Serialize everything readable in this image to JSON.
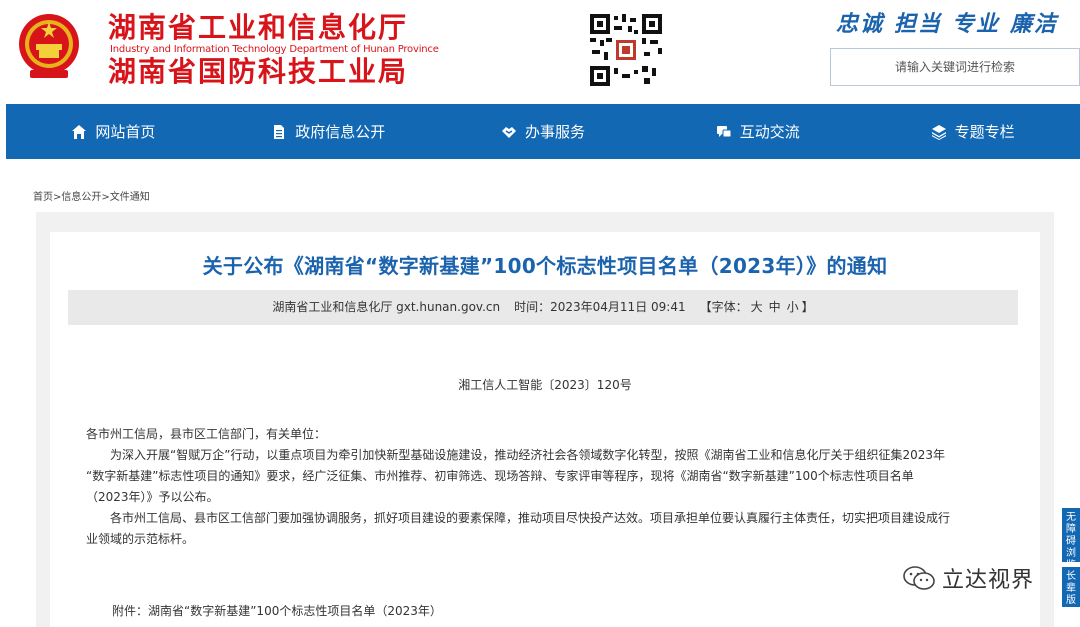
{
  "header": {
    "title_line1": "湖南省工业和信息化厅",
    "title_en": "Industry and Information Technology Department of Hunan Province",
    "title_line2": "湖南省国防科技工业局",
    "slogan": [
      "忠诚",
      "担当",
      "专业",
      "廉洁"
    ],
    "search_placeholder": "请输入关键词进行检索",
    "brand_color": "#d8141b",
    "accent_color": "#1368b4"
  },
  "nav": {
    "items": [
      {
        "label": "网站首页",
        "icon": "home-icon"
      },
      {
        "label": "政府信息公开",
        "icon": "document-icon"
      },
      {
        "label": "办事服务",
        "icon": "handshake-icon"
      },
      {
        "label": "互动交流",
        "icon": "chat-icon"
      },
      {
        "label": "专题专栏",
        "icon": "layers-icon"
      }
    ]
  },
  "breadcrumb": [
    "首页",
    "信息公开",
    "文件通知"
  ],
  "article": {
    "title": "关于公布《湖南省“数字新基建”100个标志性项目名单（2023年）》的通知",
    "source": "湖南省工业和信息化厅 gxt.hunan.gov.cn",
    "time": "时间：2023年04月11日 09:41",
    "font_label": "【字体：",
    "font_sizes": [
      "大",
      "中",
      "小"
    ],
    "font_close": "】",
    "doc_number": "湘工信人工智能〔2023〕120号",
    "salutation": "各市州工信局，县市区工信部门，有关单位：",
    "para1_line1": "为深入开展“智赋万企”行动，以重点项目为牵引加快新型基础设施建设，推动经济社会各领域数字化转型，按照《湖南省工业和信息化厅关于组织征集2023年",
    "para1_line2": "“数字新基建”标志性项目的通知》要求，经广泛征集、市州推荐、初审筛选、现场答辩、专家评审等程序，现将《湖南省“数字新基建”100个标志性项目名单",
    "para1_line3": "（2023年）》予以公布。",
    "para2_line1": "各市州工信局、县市区工信部门要加强协调服务，抓好项目建设的要素保障，推动项目尽快投产达效。项目承担单位要认真履行主体责任，切实把项目建设成行",
    "para2_line2": "业领域的示范标杆。",
    "attachment": "附件：湖南省“数字新基建”100个标志性项目名单（2023年）"
  },
  "watermark": "立达视界",
  "float_tabs": [
    "无障碍浏览",
    "长辈版"
  ]
}
